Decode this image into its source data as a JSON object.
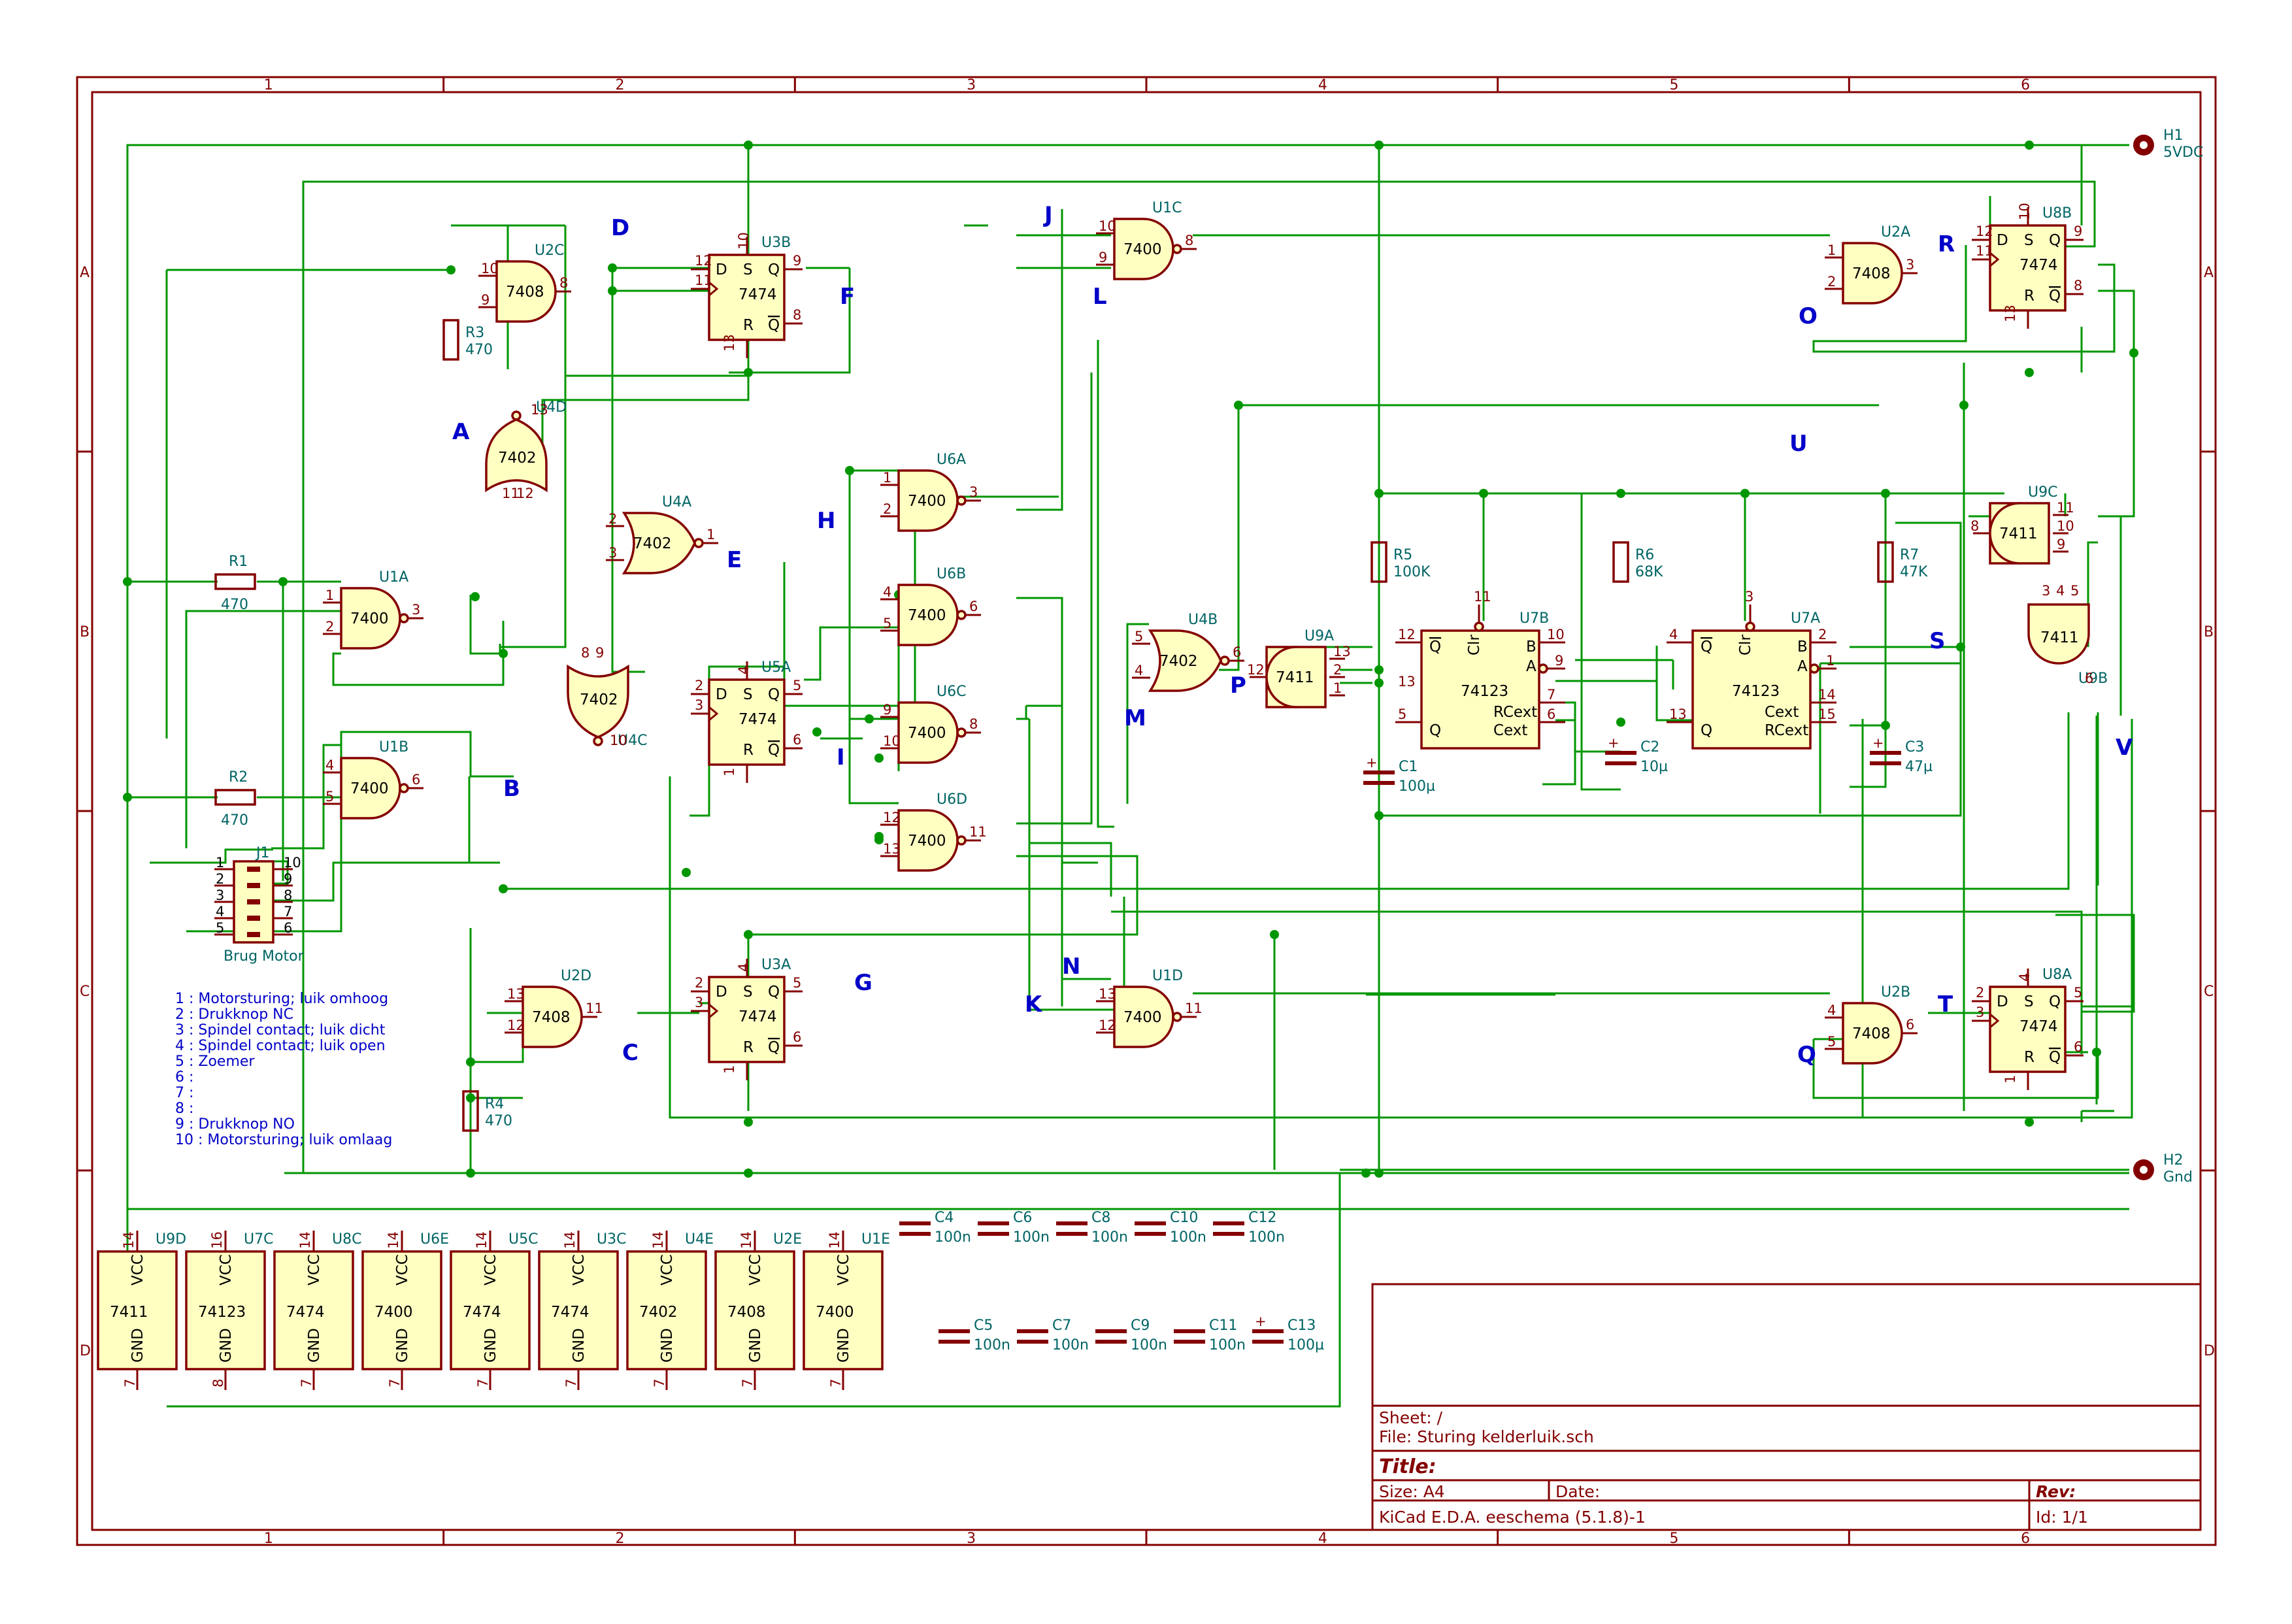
{
  "border_columns": [
    "1",
    "2",
    "3",
    "4",
    "5",
    "6"
  ],
  "border_rows": [
    "A",
    "B",
    "C",
    "D"
  ],
  "gates": [
    {
      "ref": "U2C",
      "type": "7408",
      "pins": [
        "10",
        "9",
        "8"
      ]
    },
    {
      "ref": "U1C",
      "type": "7400",
      "pins": [
        "10",
        "9",
        "8"
      ]
    },
    {
      "ref": "U2A",
      "type": "7408",
      "pins": [
        "1",
        "2",
        "3"
      ]
    },
    {
      "ref": "U1A",
      "type": "7400",
      "pins": [
        "1",
        "2",
        "3"
      ]
    },
    {
      "ref": "U1B",
      "type": "7400",
      "pins": [
        "4",
        "5",
        "6"
      ]
    },
    {
      "ref": "U6A",
      "type": "7400",
      "pins": [
        "1",
        "2",
        "3"
      ]
    },
    {
      "ref": "U6B",
      "type": "7400",
      "pins": [
        "4",
        "5",
        "6"
      ]
    },
    {
      "ref": "U6C",
      "type": "7400",
      "pins": [
        "9",
        "10",
        "8"
      ]
    },
    {
      "ref": "U6D",
      "type": "7400",
      "pins": [
        "12",
        "13",
        "11"
      ]
    },
    {
      "ref": "U2D",
      "type": "7408",
      "pins": [
        "13",
        "12",
        "11"
      ]
    },
    {
      "ref": "U1D",
      "type": "7400",
      "pins": [
        "13",
        "12",
        "11"
      ]
    },
    {
      "ref": "U2B",
      "type": "7408",
      "pins": [
        "4",
        "5",
        "6"
      ]
    },
    {
      "ref": "U4A",
      "type": "7402",
      "pins": [
        "2",
        "3",
        "1"
      ]
    },
    {
      "ref": "U4B",
      "type": "7402",
      "pins": [
        "5",
        "4",
        "6"
      ]
    },
    {
      "ref": "U9A",
      "type": "7411",
      "pins": [
        "13",
        "2",
        "1",
        "12"
      ]
    },
    {
      "ref": "U9C",
      "type": "7411",
      "pins": [
        "11",
        "10",
        "9",
        "8"
      ]
    }
  ],
  "rot_gates": [
    {
      "ref": "U4D",
      "type": "7402",
      "pins": [
        "11",
        "12",
        "13"
      ]
    },
    {
      "ref": "U4C",
      "type": "7402",
      "pins": [
        "8",
        "9",
        "10"
      ]
    },
    {
      "ref": "U9B",
      "type": "7411",
      "pins": [
        "3",
        "4",
        "5",
        "6"
      ]
    }
  ],
  "flipflops": [
    {
      "ref": "U3B",
      "type": "7474",
      "pins": [
        "12",
        "11",
        "10",
        "13",
        "9",
        "8"
      ]
    },
    {
      "ref": "U5A",
      "type": "7474",
      "pins": [
        "2",
        "3",
        "4",
        "1",
        "5",
        "6"
      ]
    },
    {
      "ref": "U3A",
      "type": "7474",
      "pins": [
        "2",
        "3",
        "4",
        "1",
        "5",
        "6"
      ]
    },
    {
      "ref": "U8B",
      "type": "7474",
      "pins": [
        "12",
        "11",
        "10",
        "13",
        "9",
        "8"
      ]
    },
    {
      "ref": "U8A",
      "type": "7474",
      "pins": [
        "2",
        "3",
        "4",
        "1",
        "5",
        "6"
      ]
    }
  ],
  "ff_labels": {
    "d": "D",
    "s": "S",
    "q": "Q",
    "r": "R",
    "qn": "Q"
  },
  "monos": [
    {
      "ref": "U7B",
      "type": "74123",
      "pins": [
        "12",
        "11",
        "10",
        "9",
        "5",
        "7",
        "6",
        "13"
      ]
    },
    {
      "ref": "U7A",
      "type": "74123",
      "pins": [
        "4",
        "3",
        "2",
        "1",
        "13",
        "14",
        "15"
      ]
    }
  ],
  "mono_labels": {
    "q_bar": "Q",
    "clr": "Clr",
    "b": "B",
    "a": "A",
    "q": "Q",
    "rcext": "RCext",
    "cext": "Cext"
  },
  "resistors": [
    {
      "ref": "R1",
      "value": "470"
    },
    {
      "ref": "R2",
      "value": "470"
    },
    {
      "ref": "R3",
      "value": "470"
    },
    {
      "ref": "R4",
      "value": "470"
    },
    {
      "ref": "R5",
      "value": "100K"
    },
    {
      "ref": "R6",
      "value": "68K"
    },
    {
      "ref": "R7",
      "value": "47K"
    }
  ],
  "capacitors": [
    {
      "ref": "C1",
      "value": "100µ"
    },
    {
      "ref": "C2",
      "value": "10µ"
    },
    {
      "ref": "C3",
      "value": "47µ"
    },
    {
      "ref": "C4",
      "value": "100n"
    },
    {
      "ref": "C5",
      "value": "100n"
    },
    {
      "ref": "C6",
      "value": "100n"
    },
    {
      "ref": "C7",
      "value": "100n"
    },
    {
      "ref": "C8",
      "value": "100n"
    },
    {
      "ref": "C9",
      "value": "100n"
    },
    {
      "ref": "C10",
      "value": "100n"
    },
    {
      "ref": "C11",
      "value": "100n"
    },
    {
      "ref": "C12",
      "value": "100n"
    },
    {
      "ref": "C13",
      "value": "100µ"
    }
  ],
  "mounting": [
    {
      "ref": "H1",
      "value": "5VDC"
    },
    {
      "ref": "H2",
      "value": "Gnd"
    }
  ],
  "power_units": [
    {
      "ref": "U9D",
      "type": "7411",
      "vcc_pin": "14",
      "gnd_pin": "7"
    },
    {
      "ref": "U7C",
      "type": "74123",
      "vcc_pin": "16",
      "gnd_pin": "8"
    },
    {
      "ref": "U8C",
      "type": "7474",
      "vcc_pin": "14",
      "gnd_pin": "7"
    },
    {
      "ref": "U6E",
      "type": "7400",
      "vcc_pin": "14",
      "gnd_pin": "7"
    },
    {
      "ref": "U5C",
      "type": "7474",
      "vcc_pin": "14",
      "gnd_pin": "7"
    },
    {
      "ref": "U3C",
      "type": "7474",
      "vcc_pin": "14",
      "gnd_pin": "7"
    },
    {
      "ref": "U4E",
      "type": "7402",
      "vcc_pin": "14",
      "gnd_pin": "7"
    },
    {
      "ref": "U2E",
      "type": "7408",
      "vcc_pin": "14",
      "gnd_pin": "7"
    },
    {
      "ref": "U1E",
      "type": "7400",
      "vcc_pin": "14",
      "gnd_pin": "7"
    }
  ],
  "power_labels": {
    "vcc": "VCC",
    "gnd": "GND"
  },
  "connector": {
    "ref": "J1",
    "value": "Brug Motor",
    "left_pins": [
      "1",
      "2",
      "3",
      "4",
      "5"
    ],
    "right_pins": [
      "10",
      "9",
      "8",
      "7",
      "6"
    ]
  },
  "net_labels": [
    "D",
    "F",
    "J",
    "L",
    "R",
    "O",
    "A",
    "U",
    "H",
    "E",
    "B",
    "M",
    "P",
    "I",
    "S",
    "V",
    "G",
    "N",
    "K",
    "C",
    "T",
    "Q"
  ],
  "pin_notes": [
    "1 : Motorsturing; luik omhoog",
    "2 : Drukknop NC",
    "3 : Spindel contact; luik dicht",
    "4 : Spindel contact; luik open",
    "5 : Zoemer",
    "6 :",
    "7 :",
    "8 :",
    "9 : Drukknop NO",
    "10 : Motorsturing; luik omlaag"
  ],
  "title_block": {
    "sheet": "Sheet: /",
    "file": "File: Sturing kelderluik.sch",
    "title": "Title:",
    "size": "Size: A4",
    "date": "Date:",
    "rev": "Rev:",
    "tool": "KiCad E.D.A.  eeschema (5.1.8)-1",
    "id": "Id: 1/1"
  },
  "colors": {
    "frame": "#840000",
    "wire": "#009600",
    "component_fill": "#ffffc2",
    "reference": "#006464",
    "net_label": "#0000c8"
  }
}
